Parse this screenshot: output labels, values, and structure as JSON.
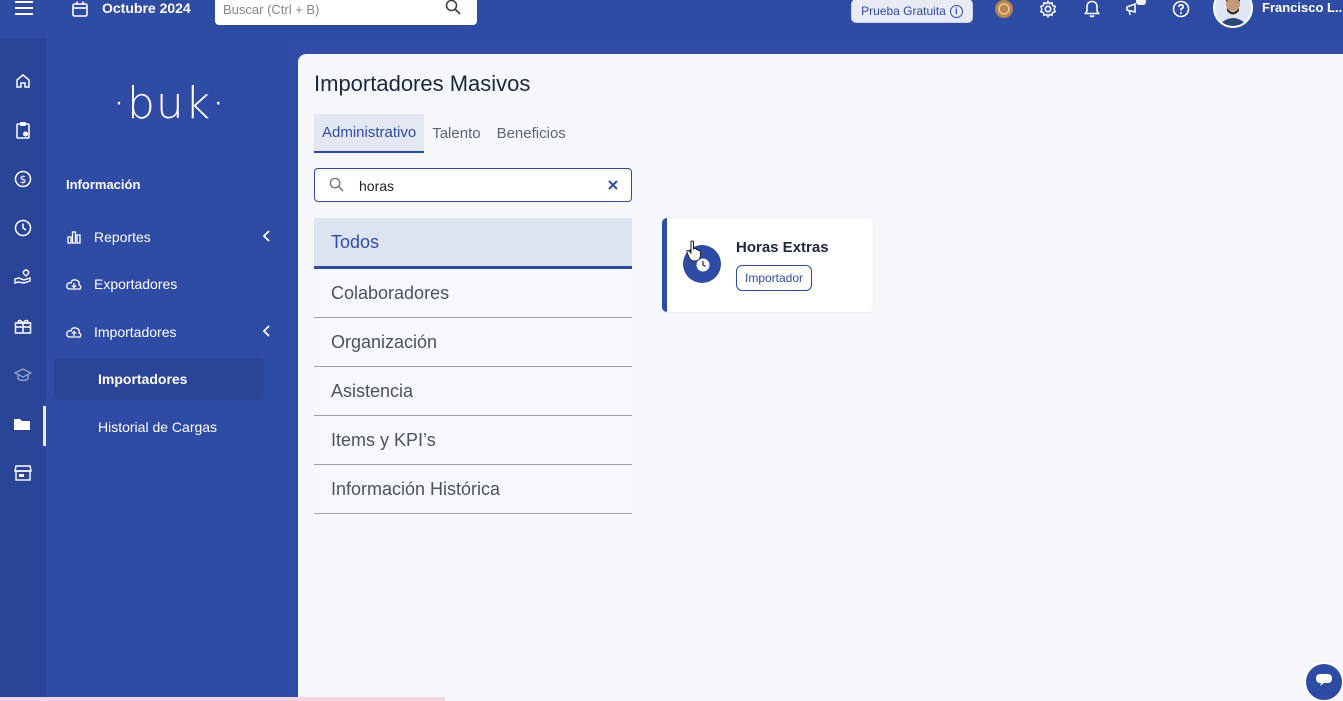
{
  "topbar": {
    "date_label": "Octubre 2024",
    "search_placeholder": "Buscar (Ctrl + B)",
    "trial_label": "Prueba Gratuita",
    "trial_info": "i",
    "user_name": "Francisco L..."
  },
  "nav": {
    "logo": "·buk·",
    "section": "Información",
    "items": [
      {
        "label": "Reportes"
      },
      {
        "label": "Exportadores"
      },
      {
        "label": "Importadores"
      }
    ],
    "subitems": [
      {
        "label": "Importadores"
      },
      {
        "label": "Historial de Cargas"
      }
    ]
  },
  "main": {
    "title": "Importadores Masivos",
    "tabs": [
      {
        "label": "Administrativo"
      },
      {
        "label": "Talento"
      },
      {
        "label": "Beneficios"
      }
    ],
    "filter_value": "horas",
    "categories": [
      {
        "label": "Todos"
      },
      {
        "label": "Colaboradores"
      },
      {
        "label": "Organización"
      },
      {
        "label": "Asistencia"
      },
      {
        "label": "Items y KPI’s"
      },
      {
        "label": "Información Histórica"
      }
    ],
    "card": {
      "title": "Horas Extras",
      "badge": "Importador"
    }
  },
  "colors": {
    "primary": "#2f4ca5",
    "rail": "#2a4497",
    "background": "#f5f7fa"
  }
}
